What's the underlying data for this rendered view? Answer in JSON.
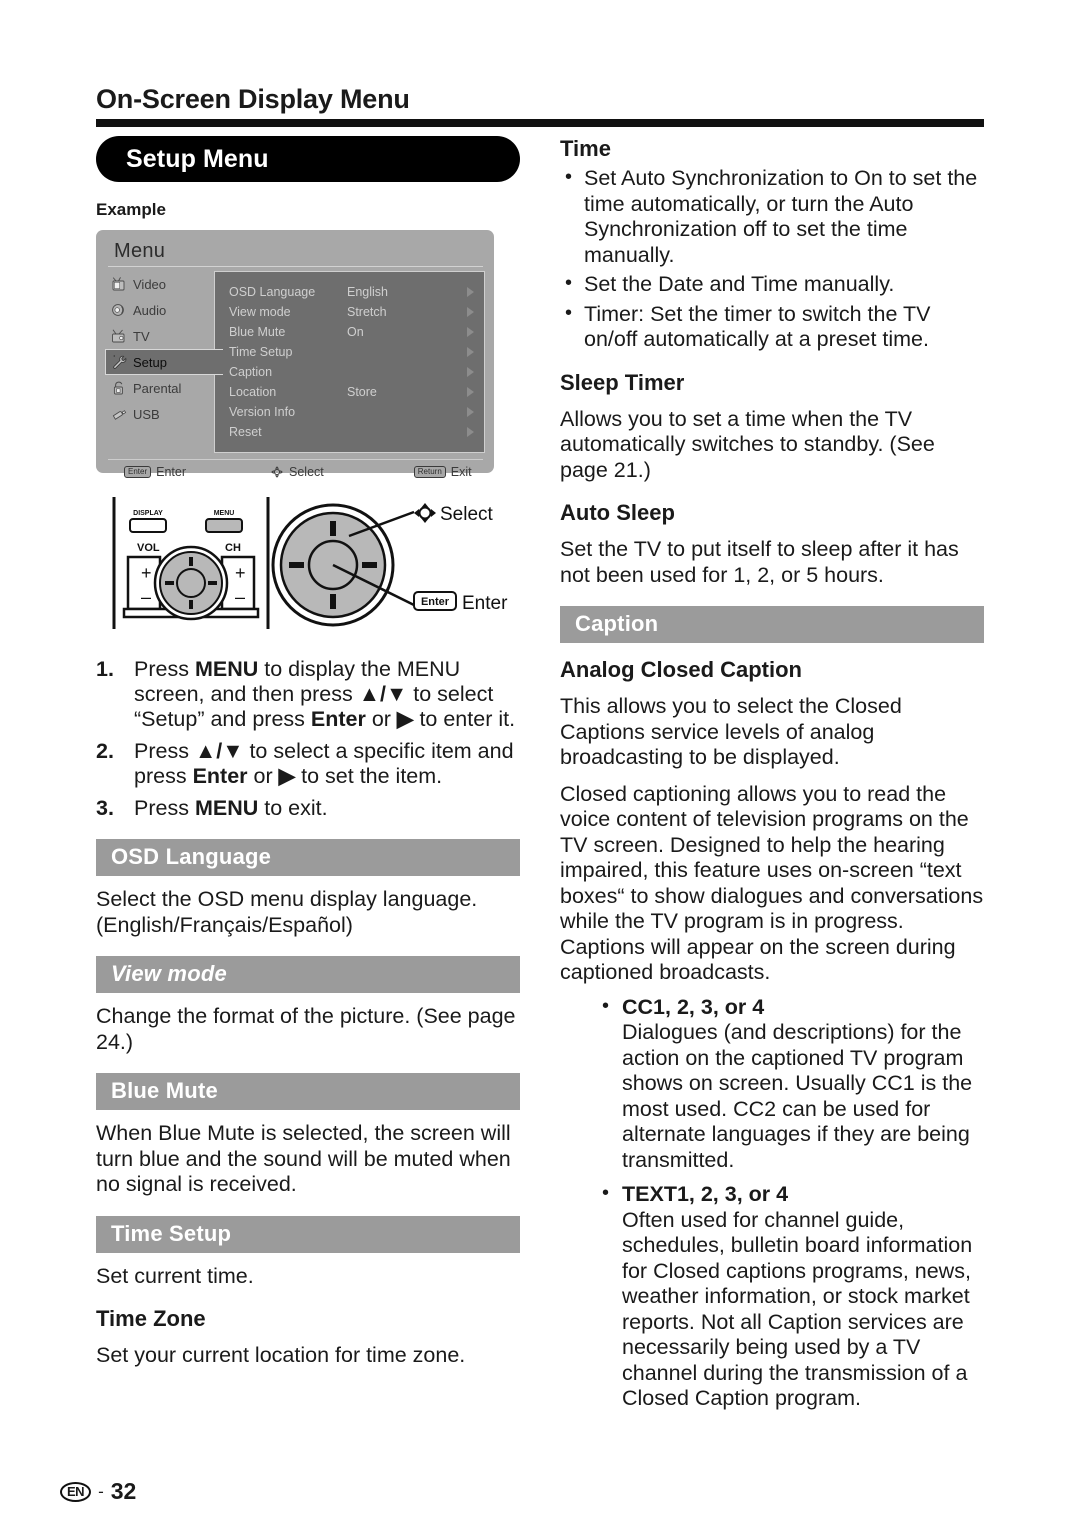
{
  "page": {
    "title": "On-Screen Display Menu",
    "footer_lang": "EN",
    "footer_dash": "-",
    "footer_page": "32"
  },
  "left": {
    "pill_heading": "Setup Menu",
    "example_label": "Example",
    "tv_menu": {
      "title": "Menu",
      "sidebar": [
        {
          "label": "Video",
          "icon": "tv-video-icon",
          "selected": false
        },
        {
          "label": "Audio",
          "icon": "speaker-audio-icon",
          "selected": false
        },
        {
          "label": "TV",
          "icon": "tv-antenna-icon",
          "selected": false
        },
        {
          "label": "Setup",
          "icon": "wrench-setup-icon",
          "selected": true
        },
        {
          "label": "Parental",
          "icon": "lock-parental-icon",
          "selected": false
        },
        {
          "label": "USB",
          "icon": "usb-stick-icon",
          "selected": false
        }
      ],
      "rows": [
        {
          "label": "OSD Language",
          "value": "English"
        },
        {
          "label": "View mode",
          "value": "Stretch"
        },
        {
          "label": "Blue Mute",
          "value": "On"
        },
        {
          "label": "Time Setup",
          "value": ""
        },
        {
          "label": "Caption",
          "value": ""
        },
        {
          "label": "Location",
          "value": "Store"
        },
        {
          "label": "Version Info",
          "value": ""
        },
        {
          "label": "Reset",
          "value": ""
        }
      ],
      "footer": {
        "enter_key": "Enter",
        "enter_label": "Enter",
        "select_label": "Select",
        "return_key": "Return",
        "exit_label": "Exit"
      }
    },
    "remote": {
      "display_label": "DISPLAY",
      "menu_label": "MENU",
      "vol_label": "VOL",
      "ch_label": "CH",
      "vol_plus": "+",
      "vol_minus": "–",
      "ch_plus": "+",
      "ch_minus": "–",
      "select_callout": "Select",
      "enter_key": "Enter",
      "enter_callout": "Enter"
    },
    "steps": [
      {
        "num": "1.",
        "parts": [
          {
            "t": "Press ",
            "b": false
          },
          {
            "t": "MENU",
            "b": true
          },
          {
            "t": " to display the MENU screen, and then press ",
            "b": false
          },
          {
            "t": "▲/▼",
            "b": true
          },
          {
            "t": " to select “Setup” and press ",
            "b": false
          },
          {
            "t": "Enter",
            "b": true
          },
          {
            "t": " or ",
            "b": false
          },
          {
            "t": "▶",
            "b": true
          },
          {
            "t": " to enter it.",
            "b": false
          }
        ]
      },
      {
        "num": "2.",
        "parts": [
          {
            "t": "Press ",
            "b": false
          },
          {
            "t": "▲/▼",
            "b": true
          },
          {
            "t": " to select a specific item and press ",
            "b": false
          },
          {
            "t": "Enter",
            "b": true
          },
          {
            "t": " or ",
            "b": false
          },
          {
            "t": "▶",
            "b": true
          },
          {
            "t": " to set the item.",
            "b": false
          }
        ]
      },
      {
        "num": "3.",
        "parts": [
          {
            "t": "Press ",
            "b": false
          },
          {
            "t": "MENU",
            "b": true
          },
          {
            "t": " to exit.",
            "b": false
          }
        ]
      }
    ],
    "sections": [
      {
        "band": "OSD Language",
        "italic": false,
        "body": "Select the OSD menu display language. (English/Français/Español)"
      },
      {
        "band": "View mode",
        "italic": true,
        "body": "Change the format of the picture. (See page 24.)"
      },
      {
        "band": "Blue Mute",
        "italic": false,
        "body": "When Blue Mute is selected, the screen will turn blue and the sound will be muted when no signal is received."
      },
      {
        "band": "Time Setup",
        "italic": false,
        "body": "Set current time."
      }
    ],
    "time_zone": {
      "heading": "Time Zone",
      "body": "Set your current location for time zone."
    }
  },
  "right": {
    "time": {
      "heading": "Time",
      "bullets": [
        "Set Auto Synchronization to On to set the time automatically, or turn the Auto Synchronization off to set the time manually.",
        "Set the Date and Time manually.",
        "Timer: Set the timer to switch the TV on/off automatically at a preset time."
      ]
    },
    "sleep_timer": {
      "heading": "Sleep Timer",
      "body": "Allows you to set a time when the TV automatically switches to standby. (See page 21.)"
    },
    "auto_sleep": {
      "heading": "Auto Sleep",
      "body": "Set the TV to put itself to sleep after it has not been used for 1, 2, or 5 hours."
    },
    "caption_band": "Caption",
    "analog_cc": {
      "heading": "Analog Closed Caption",
      "para1": "This allows you to select the Closed Captions service levels of analog broadcasting to be displayed.",
      "para2": "Closed captioning allows you to read the voice content of television programs on the TV screen. Designed to help the hearing impaired, this feature uses on-screen “text boxes“ to show dialogues and conversations while the TV program is in progress. Captions will appear on the screen during captioned broadcasts."
    },
    "cc_items": [
      {
        "title": "CC1, 2, 3, or 4",
        "body": "Dialogues (and descriptions) for the action on the captioned TV program shows on screen. Usually CC1 is the most used. CC2 can be used for alternate languages if they are being transmitted."
      },
      {
        "title": "TEXT1, 2, 3, or 4",
        "body": "Often used for channel guide, schedules, bulletin board information for Closed captions programs, news, weather information, or stock market reports. Not all Caption services are necessarily being used by a TV channel during the transmission of a Closed Caption program."
      }
    ]
  }
}
